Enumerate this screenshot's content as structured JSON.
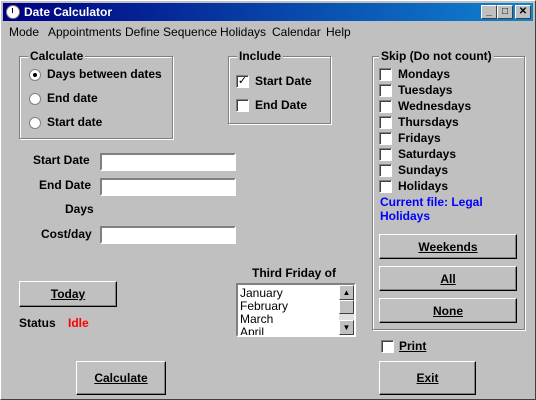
{
  "window": {
    "title": "Date Calculator",
    "minimize": "_",
    "maximize": "□",
    "close": "✕"
  },
  "menu": [
    "Mode",
    "Appointments",
    "Define Sequence",
    "Holidays",
    "Calendar",
    "Help"
  ],
  "calculate": {
    "label": "Calculate",
    "options": [
      "Days between dates",
      "End date",
      "Start date"
    ],
    "selected": "Days between dates"
  },
  "include": {
    "label": "Include",
    "start_date": {
      "label": "Start Date",
      "checked": true
    },
    "end_date": {
      "label": "End Date",
      "checked": false
    }
  },
  "fields": {
    "start_date": {
      "label": "Start Date",
      "value": ""
    },
    "end_date": {
      "label": "End Date",
      "value": ""
    },
    "days": {
      "label": "Days"
    },
    "cost": {
      "label": "Cost/day",
      "value": ""
    }
  },
  "skip": {
    "label": "Skip (Do not count)",
    "days": [
      "Mondays",
      "Tuesdays",
      "Wednesdays",
      "Thursdays",
      "Fridays",
      "Saturdays",
      "Sundays",
      "Holidays"
    ],
    "current_file": "Current file: Legal Holidays",
    "current_file_color": "#0000ff",
    "buttons": {
      "weekends": "Weekends",
      "all": "All",
      "none": "None"
    }
  },
  "third_friday": {
    "label": "Third Friday of",
    "months": [
      "January",
      "February",
      "March",
      "April"
    ]
  },
  "today_button": "Today",
  "status": {
    "label": "Status",
    "value": "Idle",
    "value_color": "#ff0000"
  },
  "print": {
    "label": "Print",
    "checked": false
  },
  "calculate_button": "Calculate",
  "exit_button": "Exit"
}
